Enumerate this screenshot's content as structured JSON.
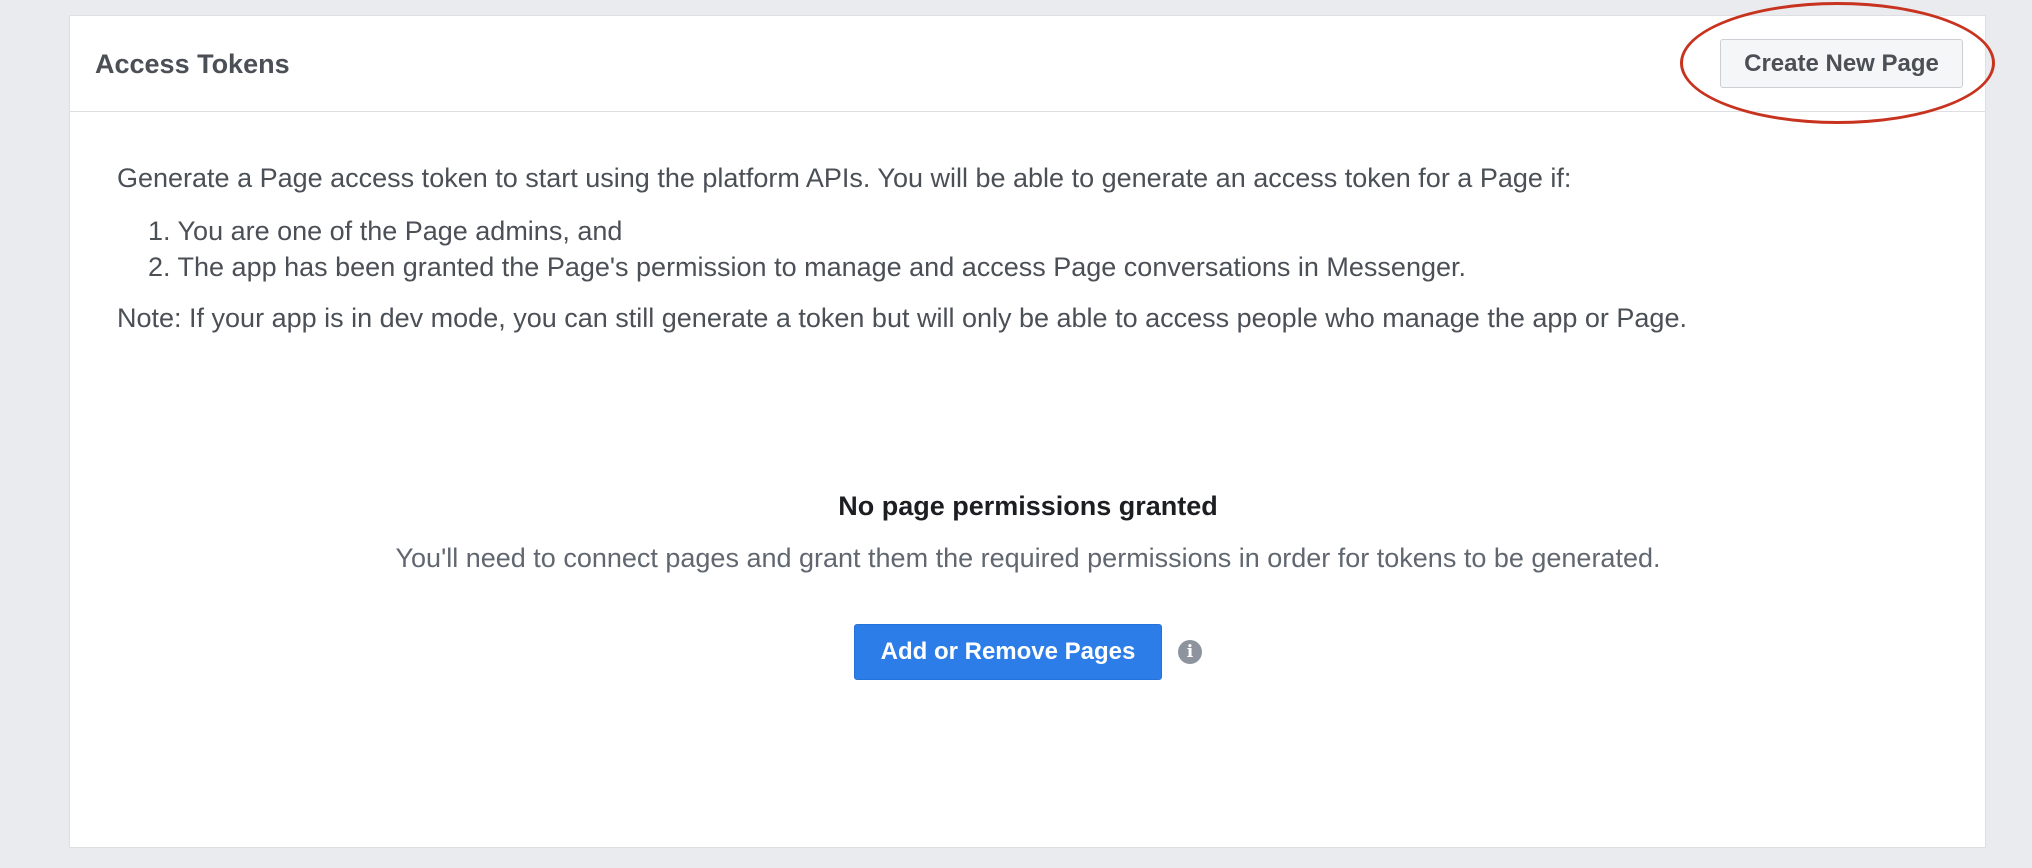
{
  "panel": {
    "title": "Access Tokens",
    "create_page_label": "Create New Page"
  },
  "content": {
    "intro": "Generate a Page access token to start using the platform APIs. You will be able to generate an access token for a Page if:",
    "steps": [
      "1. You are one of the Page admins, and",
      "2. The app has been granted the Page's permission to manage and access Page conversations in Messenger."
    ],
    "note": "Note: If your app is in dev mode, you can still generate a token but will only be able to access people who manage the app or Page."
  },
  "empty_state": {
    "title": "No page permissions granted",
    "description": "You'll need to connect pages and grant them the required permissions in order for tokens to be generated.",
    "button_label": "Add or Remove Pages",
    "info_icon_glyph": "i"
  },
  "icons": {
    "info": "info-icon"
  },
  "colors": {
    "primary_button": "#2d7de8",
    "highlight_annotation": "#c8331f",
    "background": "#e9ebee"
  }
}
